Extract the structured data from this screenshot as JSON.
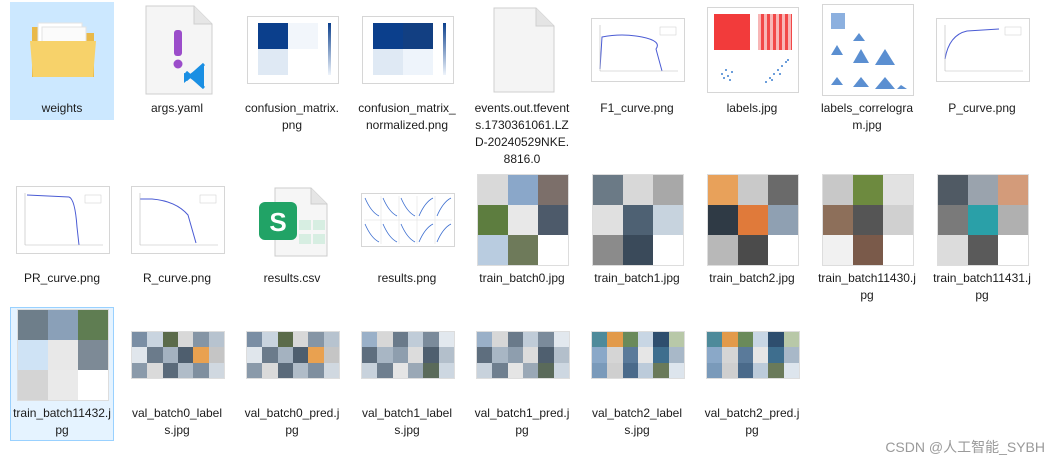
{
  "files": [
    {
      "name": "weights",
      "kind": "folder"
    },
    {
      "name": "args.yaml",
      "kind": "yaml"
    },
    {
      "name": "confusion_matrix.png",
      "kind": "matrix"
    },
    {
      "name": "confusion_matrix_normalized.png",
      "kind": "matrix"
    },
    {
      "name": "events.out.tfevents.1730361061.LZD-20240529NKE.8816.0",
      "kind": "blank"
    },
    {
      "name": "F1_curve.png",
      "kind": "curve-down"
    },
    {
      "name": "labels.jpg",
      "kind": "labels"
    },
    {
      "name": "labels_correlogram.jpg",
      "kind": "correlogram"
    },
    {
      "name": "P_curve.png",
      "kind": "curve-up"
    },
    {
      "name": "PR_curve.png",
      "kind": "curve-pr"
    },
    {
      "name": "R_curve.png",
      "kind": "curve-r"
    },
    {
      "name": "results.csv",
      "kind": "csv"
    },
    {
      "name": "results.png",
      "kind": "results"
    },
    {
      "name": "train_batch0.jpg",
      "kind": "mosaic"
    },
    {
      "name": "train_batch1.jpg",
      "kind": "mosaic"
    },
    {
      "name": "train_batch2.jpg",
      "kind": "mosaic"
    },
    {
      "name": "train_batch11430.jpg",
      "kind": "mosaic"
    },
    {
      "name": "train_batch11431.jpg",
      "kind": "mosaic"
    },
    {
      "name": "train_batch11432.jpg",
      "kind": "mosaic"
    },
    {
      "name": "val_batch0_labels.jpg",
      "kind": "wide"
    },
    {
      "name": "val_batch0_pred.jpg",
      "kind": "wide"
    },
    {
      "name": "val_batch1_labels.jpg",
      "kind": "wide"
    },
    {
      "name": "val_batch1_pred.jpg",
      "kind": "wide"
    },
    {
      "name": "val_batch2_labels.jpg",
      "kind": "wide"
    },
    {
      "name": "val_batch2_pred.jpg",
      "kind": "wide"
    }
  ],
  "watermark": "CSDN @人工智能_SYBH",
  "colors": {
    "hover": "#cce8ff",
    "selected_bg": "#e5f3ff",
    "selected_border": "#99d1ff",
    "folder": "#f7d26a",
    "csv_green": "#21a366",
    "yaml_purple": "#9b4dca",
    "vscode_blue": "#1a8fe3"
  }
}
